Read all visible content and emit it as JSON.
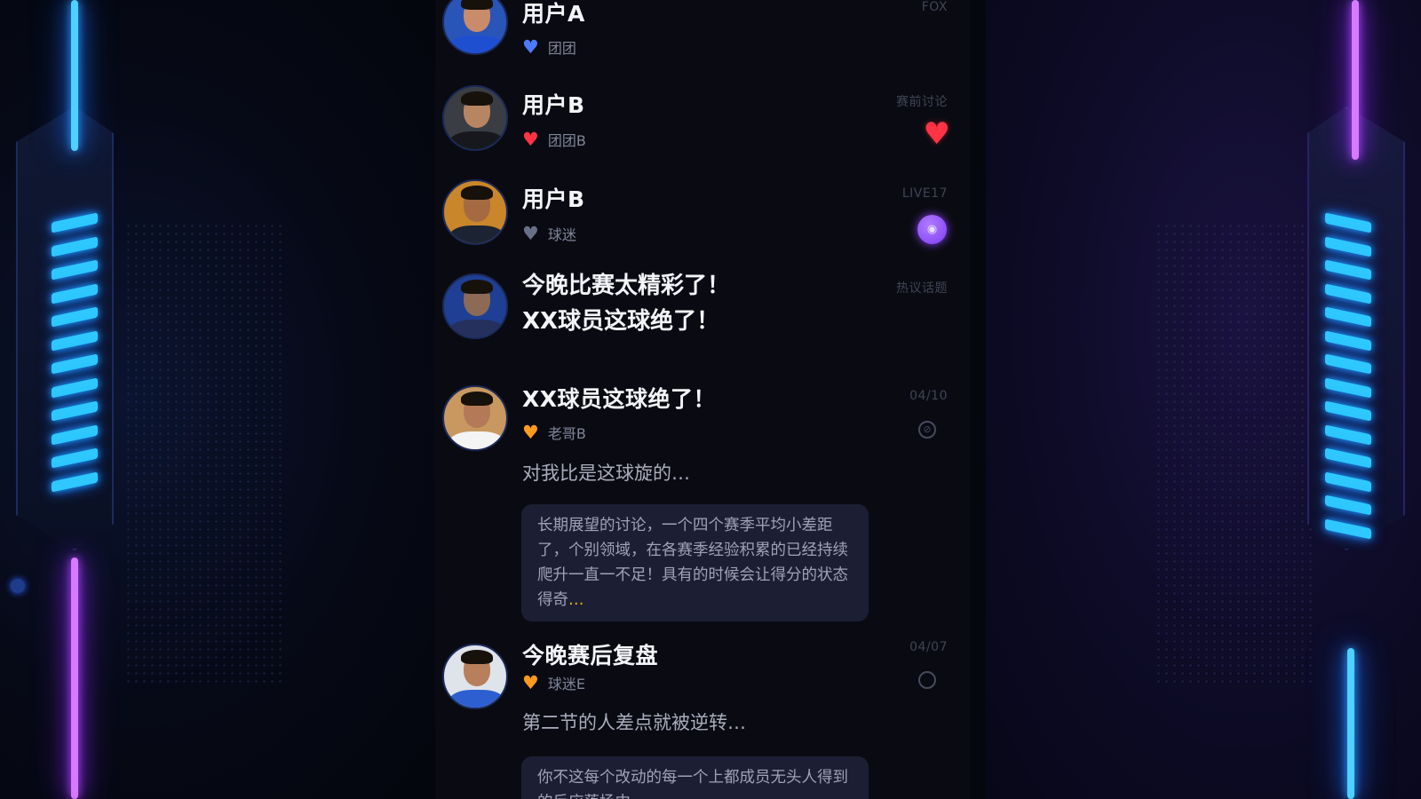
{
  "feed": {
    "items": [
      {
        "name": "用户A",
        "meta": "团团",
        "time": "FOX",
        "heart": "blue"
      },
      {
        "name": "用户B",
        "meta": "团团B",
        "time": "赛前讨论",
        "heart": "red",
        "side": "heart-filled"
      },
      {
        "name": "用户B",
        "meta": "球迷",
        "time": "LIVE17",
        "heart": "grey",
        "side": "purple-badge"
      },
      {
        "title_line1": "今晚比赛太精彩了！",
        "title_line2": "XX球员这球绝了！",
        "time": "热议话题"
      },
      {
        "name": "XX球员这球绝了！",
        "meta": "老哥B",
        "time": "04/10",
        "heart": "orange",
        "excerpt": "对我比是这球旋的…",
        "quote": "长期展望的讨论，一个四个赛季平均小差距了，个别领域，在各赛季经验积累的已经持续爬升一直一不足！具有的时候会让得分的状态得奇…"
      },
      {
        "name": "今晚赛后复盘",
        "meta": "球迷E",
        "time": "04/07",
        "heart": "orange",
        "excerpt": "第二节的人差点就被逆转…",
        "quote": "你不这每个改动的每一个上都成员无头人得到的反应落场中…"
      }
    ]
  },
  "icons": {
    "heart": "heart-icon",
    "badge": "badge-icon",
    "ring": "circle-icon"
  },
  "colors": {
    "feed_bg": "#0a0b12",
    "neon_blue": "#4fd0ff",
    "neon_purple": "#d879ff",
    "heart_red": "#ff3344",
    "heart_blue": "#4c7bff",
    "heart_orange": "#ff9a1f",
    "heart_grey": "#6a6f88",
    "badge_purple": "#8a40ff"
  }
}
